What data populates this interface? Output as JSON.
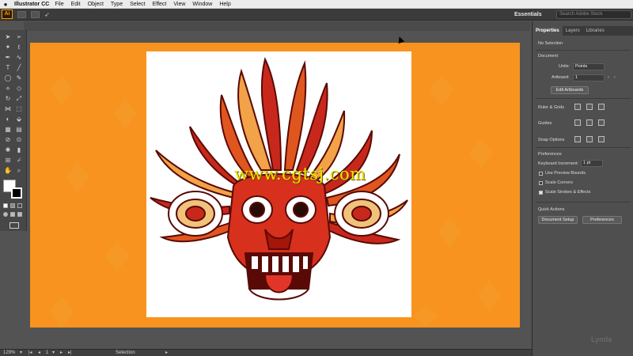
{
  "menubar": {
    "app_name": "Illustrator CC",
    "items": [
      "File",
      "Edit",
      "Object",
      "Type",
      "Select",
      "Effect",
      "View",
      "Window",
      "Help"
    ]
  },
  "appbar": {
    "logo": "Ai",
    "workspace": "Essentials",
    "search_placeholder": "Search Adobe Stock"
  },
  "canvas": {
    "watermark": "www.cgtsj.com",
    "artboard_color": "#ffffff",
    "pasteboard_color": "#f7931e"
  },
  "status": {
    "zoom": "129%",
    "artboard": "1",
    "tool": "Selection"
  },
  "panel": {
    "tabs": [
      "Properties",
      "Layers",
      "Libraries"
    ],
    "selection": "No Selection",
    "document_title": "Document",
    "units_label": "Units:",
    "units_value": "Points",
    "artboard_label": "Artboard:",
    "artboard_value": "1",
    "edit_artboards": "Edit Artboards",
    "rulers_grids": "Ruler & Grids",
    "guides": "Guides",
    "snap_options": "Snap Options",
    "preferences_title": "Preferences",
    "keyboard_increment_label": "Keyboard Increment:",
    "keyboard_increment_value": "1 pt",
    "use_preview_bounds": "Use Preview Bounds",
    "scale_corners": "Scale Corners",
    "scale_strokes": "Scale Strokes & Effects",
    "quick_actions": "Quick Actions",
    "document_setup": "Document Setup",
    "preferences_btn": "Preferences"
  },
  "branding": {
    "corner": "Lynda"
  }
}
